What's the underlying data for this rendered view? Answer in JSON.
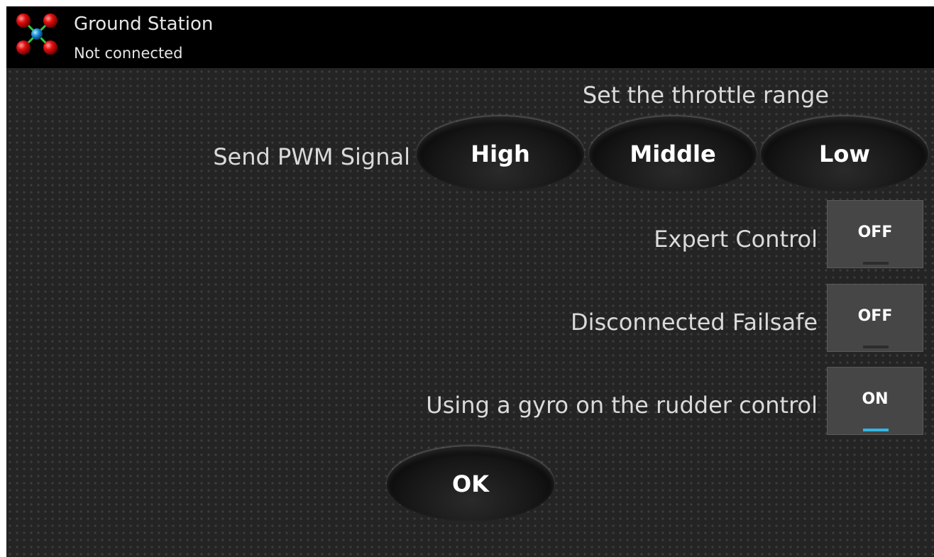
{
  "titlebar": {
    "title": "Ground Station",
    "status": "Not connected",
    "icon": "quadcopter-icon"
  },
  "throttle": {
    "heading": "Set the throttle range",
    "pwm_label": "Send PWM Signal",
    "buttons": {
      "high": "High",
      "middle": "Middle",
      "low": "Low"
    }
  },
  "settings": {
    "expert": {
      "label": "Expert Control",
      "state": "OFF"
    },
    "failsafe": {
      "label": "Disconnected Failsafe",
      "state": "OFF"
    },
    "gyro": {
      "label": "Using a gyro on the rudder control",
      "state": "ON"
    }
  },
  "ok_label": "OK",
  "colors": {
    "accent": "#33b5e5",
    "background": "#242424",
    "titlebar": "#000000"
  }
}
